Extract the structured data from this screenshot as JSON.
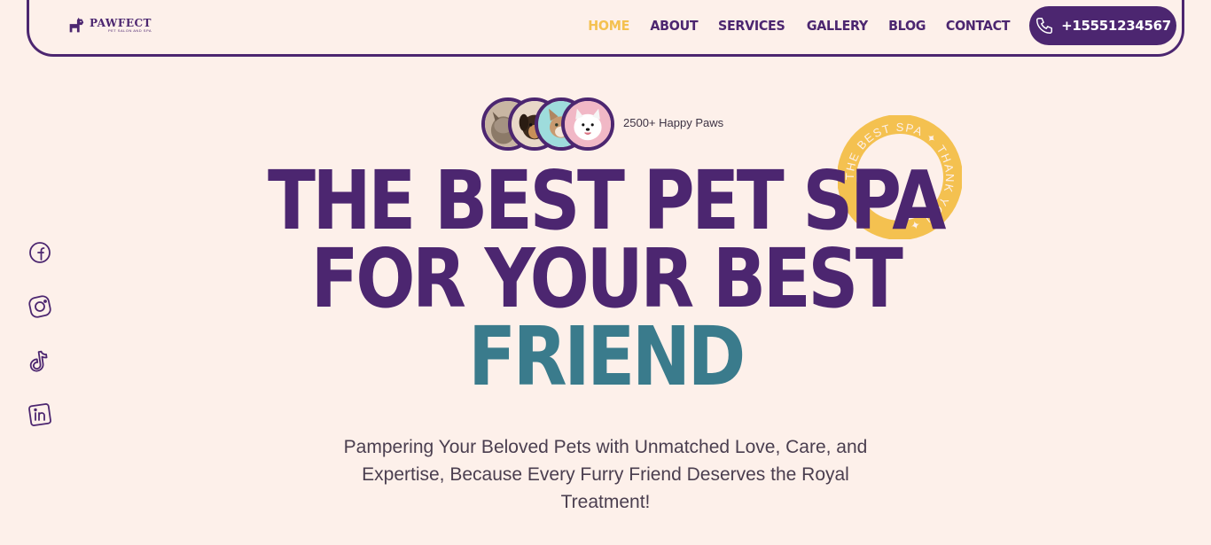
{
  "brand": {
    "name": "PAWFECT",
    "tagline": "PET SALON AND SPA"
  },
  "nav": {
    "items": [
      {
        "label": "HOME",
        "active": true
      },
      {
        "label": "ABOUT",
        "active": false
      },
      {
        "label": "SERVICES",
        "active": false
      },
      {
        "label": "GALLERY",
        "active": false
      },
      {
        "label": "BLOG",
        "active": false
      },
      {
        "label": "CONTACT",
        "active": false
      }
    ],
    "phone": "+15551234567"
  },
  "social": [
    "facebook-icon",
    "instagram-icon",
    "tiktok-icon",
    "linkedin-icon"
  ],
  "hero": {
    "happy_paws": "2500+ Happy Paws",
    "title_line1": "THE BEST PET SPA",
    "title_line2": "FOR YOUR BEST",
    "title_line3": "FRIEND",
    "subtitle": "Pampering Your Beloved Pets with Unmatched Love, Care, and Expertise, Because Every Furry Friend Deserves the Royal Treatment!",
    "badge_text": "THE BEST SPA ✦ THANK YOU ✦"
  },
  "colors": {
    "primary": "#4c2670",
    "accent": "#f4c150",
    "teal": "#3a7b8c",
    "background": "#fdf0ea"
  }
}
